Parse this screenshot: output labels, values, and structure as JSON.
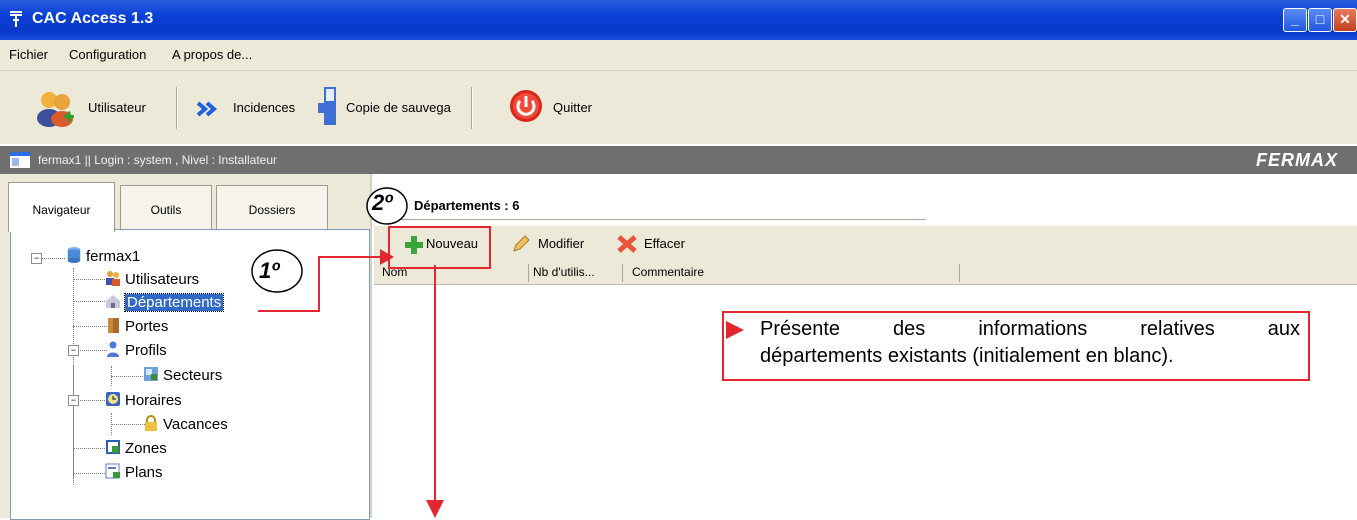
{
  "window": {
    "title": "CAC Access 1.3",
    "icon": "tau-cross-icon",
    "controls": [
      "_",
      "□",
      "✕"
    ]
  },
  "menu": {
    "items": [
      "Fichier",
      "Configuration",
      "A propos de..."
    ]
  },
  "toolbar": {
    "utilisateur": "Utilisateur",
    "incidences": "Incidences",
    "copie": "Copie de sauvega",
    "quitter": "Quitter"
  },
  "banner": {
    "text": "fermax1 || Login : system , Nivel : Installateur",
    "logo": "FERMAX"
  },
  "tabs": [
    "Navigateur",
    "Outils",
    "Dossiers"
  ],
  "tree": {
    "root": "fermax1",
    "utilisateurs": "Utilisateurs",
    "departements": "Départements",
    "portes": "Portes",
    "profils": "Profils",
    "secteurs": "Secteurs",
    "horaires": "Horaires",
    "vacances": "Vacances",
    "zones": "Zones",
    "plans": "Plans"
  },
  "main": {
    "count_label": "Départements : 6",
    "actions": {
      "nouveau": "Nouveau",
      "modifier": "Modifier",
      "effacer": "Effacer"
    },
    "columns": [
      "Nom",
      "Nb d'utilis...",
      "Commentaire"
    ]
  },
  "annotations": {
    "step1": "1º",
    "step2": "2º",
    "info_line1": "Présente des informations relatives aux",
    "info_line2": "départements existants (initialement en blanc)."
  },
  "colors": {
    "accent_red": "#e3262f",
    "titlebar_blue": "#0a3fd6",
    "banner_gray": "#6f6f6f"
  }
}
